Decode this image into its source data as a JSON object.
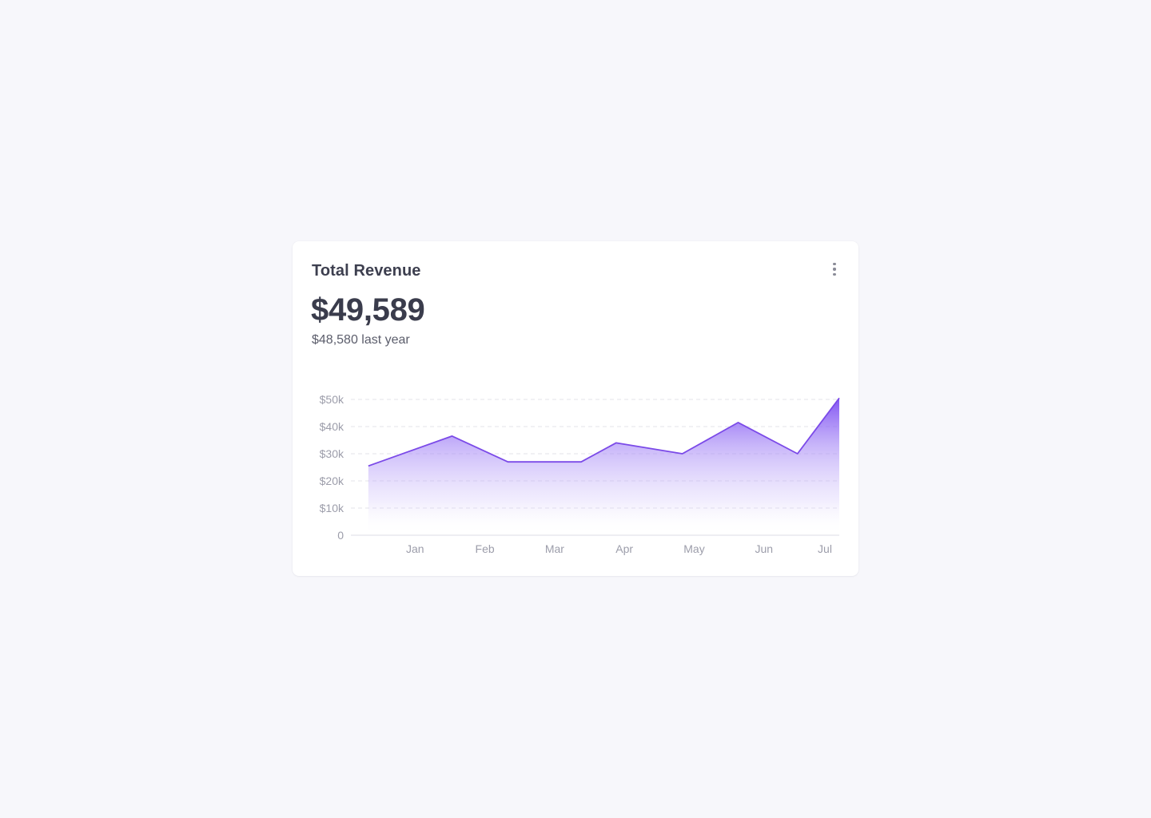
{
  "card": {
    "title": "Total Revenue",
    "value": "$49,589",
    "comparison": "$48,580 last year",
    "menu_icon": "more-vertical-icon"
  },
  "colors": {
    "accent": "#7b4ae8",
    "accent_fill_top": "#7c4cf2",
    "grid": "#e3e3ea",
    "axis_text": "#9c9daa"
  },
  "chart_data": {
    "type": "area",
    "title": "",
    "xlabel": "",
    "ylabel": "",
    "grid": true,
    "ylim": [
      0,
      50000
    ],
    "y_ticks": [
      {
        "value": 0,
        "label": "0"
      },
      {
        "value": 10000,
        "label": "$10k"
      },
      {
        "value": 20000,
        "label": "$20k"
      },
      {
        "value": 30000,
        "label": "$30k"
      },
      {
        "value": 40000,
        "label": "$40k"
      },
      {
        "value": 50000,
        "label": "$50k"
      }
    ],
    "x_ticks": [
      {
        "x": 1.0,
        "label": "Jan"
      },
      {
        "x": 2.0,
        "label": "Feb"
      },
      {
        "x": 3.0,
        "label": "Mar"
      },
      {
        "x": 4.0,
        "label": "Apr"
      },
      {
        "x": 5.0,
        "label": "May"
      },
      {
        "x": 6.0,
        "label": "Jun"
      },
      {
        "x": 7.0,
        "label": "Jul"
      }
    ],
    "series": [
      {
        "x": [
          0.25,
          1.45,
          2.25,
          3.3,
          3.8,
          4.75,
          5.55,
          6.4,
          7.2
        ],
        "values": [
          25500,
          36500,
          27000,
          27000,
          34000,
          30000,
          41500,
          30000,
          50500
        ]
      }
    ]
  }
}
